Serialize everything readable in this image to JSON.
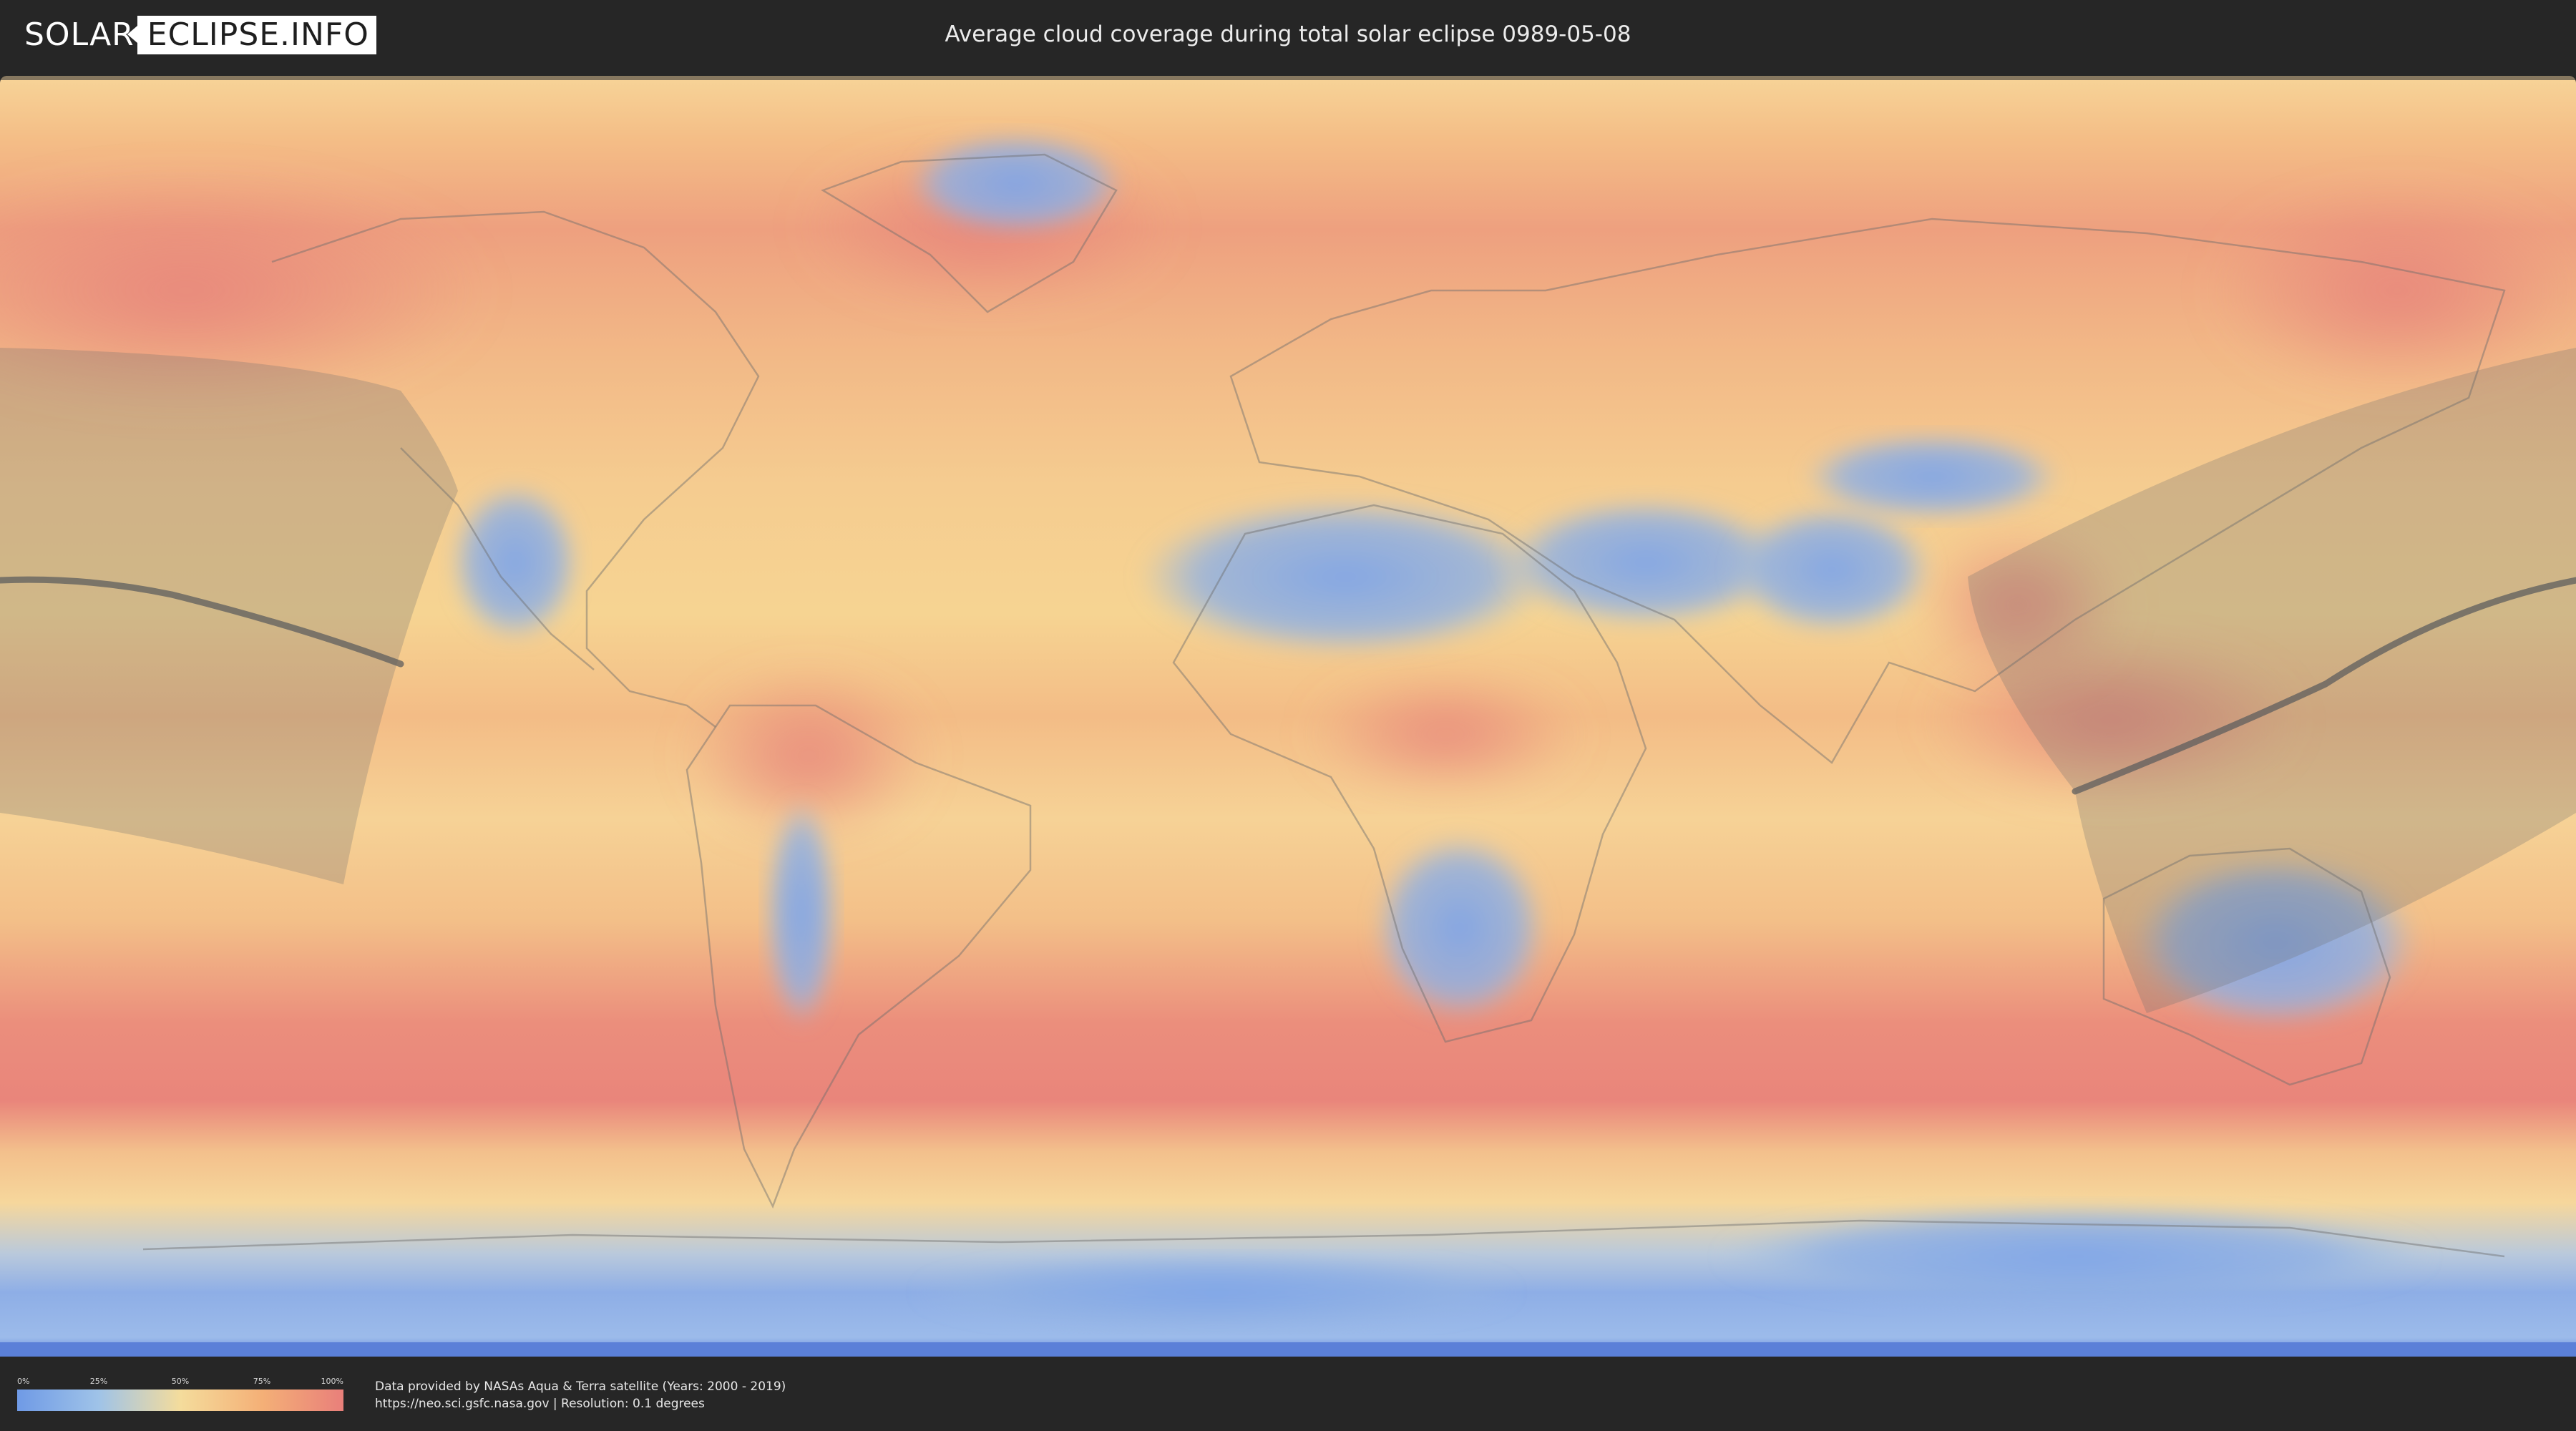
{
  "header": {
    "logo_left": "SOLAR",
    "logo_right": "ECLIPSE.INFO",
    "title": "Average cloud coverage during total solar eclipse 0989-05-08"
  },
  "map": {
    "projection": "equirectangular",
    "layers": [
      "cloud-coverage-heatmap",
      "country-borders",
      "eclipse-penumbra-region",
      "eclipse-central-path"
    ]
  },
  "legend": {
    "ticks": [
      "0%",
      "25%",
      "50%",
      "75%",
      "100%"
    ],
    "gradient_colors": [
      "#6f9ae6",
      "#9fc3e8",
      "#f4dc9c",
      "#f4b077",
      "#e97f7a"
    ]
  },
  "footer": {
    "credit_line1": "Data provided by NASAs Aqua & Terra satellite (Years: 2000 - 2019)",
    "credit_line2": "https://neo.sci.gsfc.nasa.gov | Resolution: 0.1 degrees"
  },
  "colors": {
    "background": "#262626",
    "clear_sky": "#7aa3e6",
    "mid_cover": "#f5d596",
    "full_cover": "#e8857b",
    "eclipse_overlay": "#6e6e6e"
  }
}
